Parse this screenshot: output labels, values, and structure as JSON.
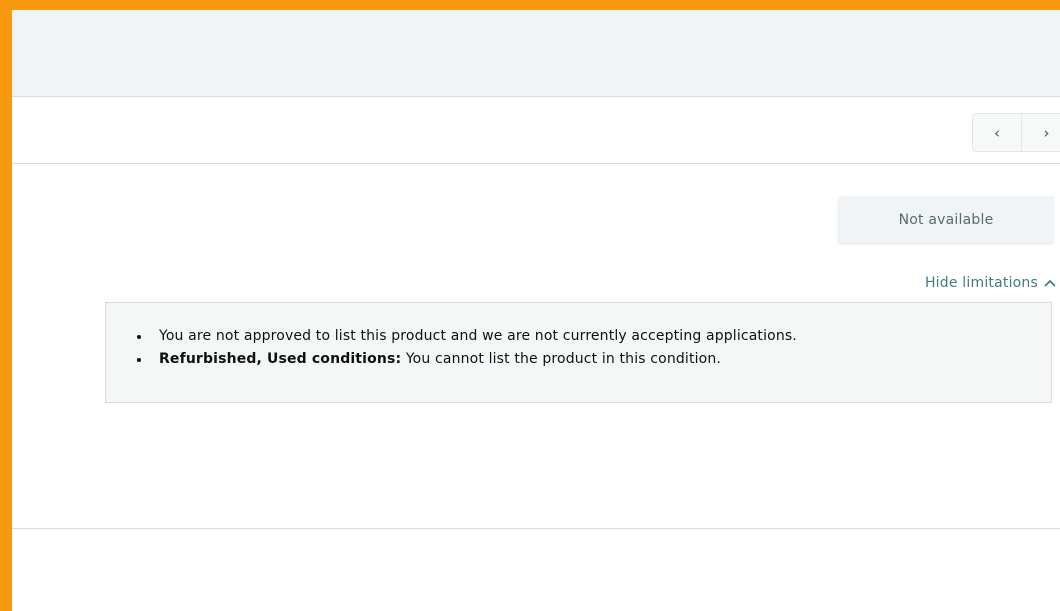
{
  "pager": {
    "prev_icon": "chevron-left-icon",
    "next_icon": "chevron-right-icon",
    "prev_glyph": "‹",
    "next_glyph": "›"
  },
  "offer": {
    "status_button_label": "Not available",
    "toggle_label": "Hide limitations",
    "toggle_icon": "chevron-up-icon"
  },
  "limitations": {
    "items": [
      {
        "bold": "",
        "text": "You are not approved to list this product and we are not currently accepting applications."
      },
      {
        "bold": "Refurbished, Used conditions:",
        "text": " You cannot list the product in this condition."
      }
    ]
  },
  "colors": {
    "frame_border": "#f7990f",
    "link": "#417b83",
    "panel_bg": "#f5f7f7",
    "header_bg": "#f1f4f6"
  }
}
